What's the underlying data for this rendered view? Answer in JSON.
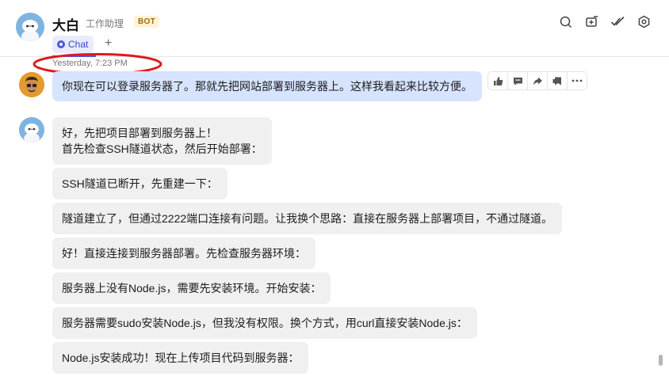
{
  "header": {
    "name": "大白",
    "subtitle": "工作助理",
    "badge": "BOT",
    "tab_label": "Chat",
    "add_tab": "+",
    "actions": [
      "search-icon",
      "new-window-icon",
      "double-check-icon",
      "gear-icon"
    ]
  },
  "timestamp": "Yesterday, 7:23 PM",
  "user_message": "你现在可以登录服务器了。那就先把网站部署到服务器上。这样我看起来比较方便。",
  "message_toolbar": [
    "thumbs-up-icon",
    "comment-icon",
    "forward-icon",
    "bookmark-icon",
    "more-icon"
  ],
  "bot_messages": [
    {
      "line1": "好，先把项目部署到服务器上！",
      "line2": "首先检查SSH隧道状态，然后开始部署："
    },
    {
      "text": "SSH隧道已断开，先重建一下："
    },
    {
      "text": "隧道建立了，但通过2222端口连接有问题。让我换个思路：直接在服务器上部署项目，不通过隧道。"
    },
    {
      "text": "好！直接连接到服务器部署。先检查服务器环境："
    },
    {
      "text": "服务器上没有Node.js，需要先安装环境。开始安装："
    },
    {
      "text": "服务器需要sudo安装Node.js，但我没有权限。换个方式，用curl直接安装Node.js："
    },
    {
      "text": "Node.js安装成功！现在上传项目代码到服务器："
    }
  ],
  "colors": {
    "accent": "#4a56e2",
    "user_bubble": "#d6e4ff",
    "bot_bubble": "#f0f0f0",
    "annotation": "#e0191f"
  }
}
